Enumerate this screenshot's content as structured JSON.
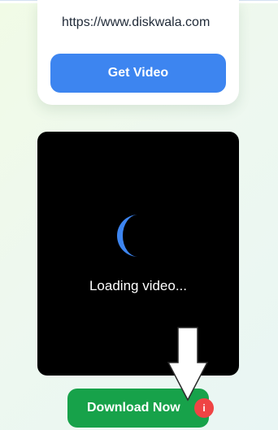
{
  "url_input": {
    "value": "https://www.diskwala.com"
  },
  "get_video_button": {
    "label": "Get Video",
    "color": "#3d85f0"
  },
  "video_player": {
    "background": "#000000",
    "loading_text": "Loading video...",
    "spinner_icon": "loading-spinner-icon"
  },
  "download_button": {
    "label": "Download Now",
    "color": "#17a24a"
  },
  "info_badge": {
    "label": "i",
    "color": "#ef4444",
    "icon": "info-icon"
  },
  "annotation": {
    "icon": "arrow-down-icon",
    "color": "#ffffff"
  }
}
